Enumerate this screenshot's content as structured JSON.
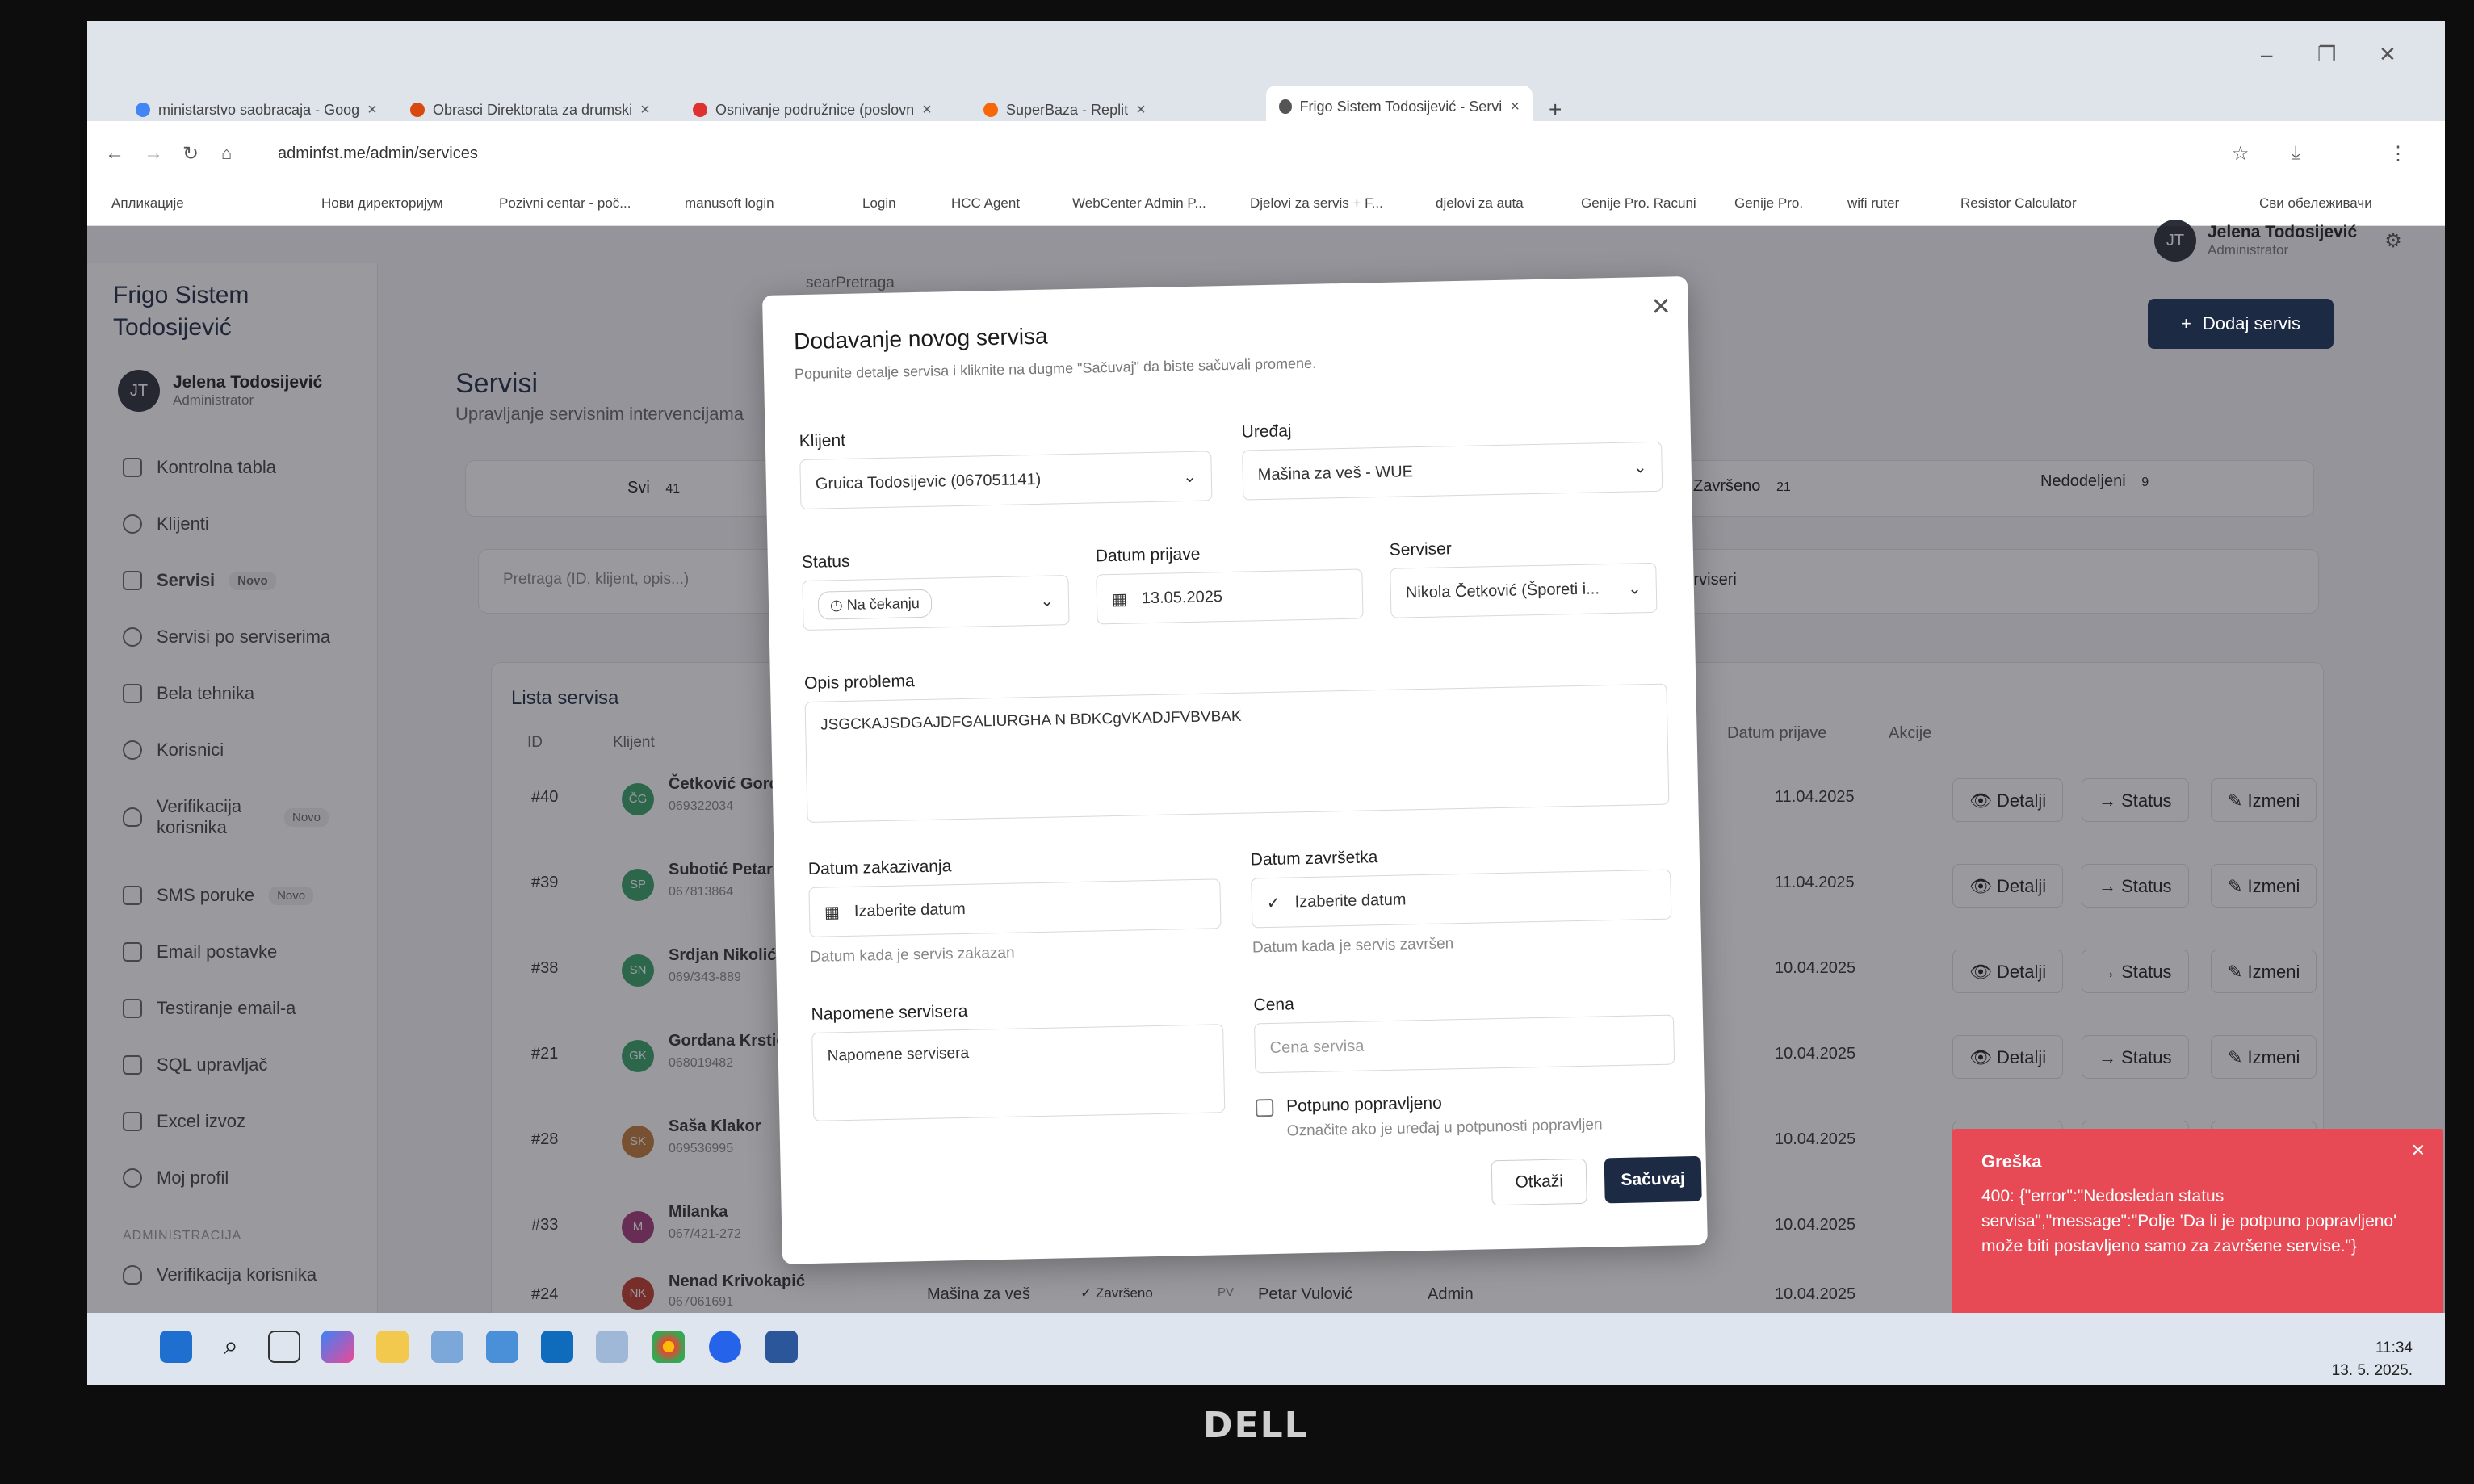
{
  "browser": {
    "tabs": [
      {
        "label": "ministarstvo saobracaja - Goog",
        "color": "#4285f4"
      },
      {
        "label": "Obrasci Direktorata za drumski",
        "color": "#d9480f"
      },
      {
        "label": "Osnivanje podružnice (poslovn",
        "color": "#e03131"
      },
      {
        "label": "SuperBaza - Replit",
        "color": "#f76707"
      },
      {
        "label": "Frigo Sistem Todosijević - Servi",
        "color": "#555555"
      }
    ],
    "url": "adminfst.me/admin/services",
    "bookmarks": [
      "Апликације",
      "Нови директоријум",
      "Pozivni centar - poč...",
      "manusoft login",
      "Login",
      "HCC Agent",
      "WebCenter Admin P...",
      "Djelovi za servis + F...",
      "djelovi za auta",
      "Genije Pro. Racuni",
      "Genije Pro.",
      "wifi ruter",
      "Resistor Calculator",
      "Сви обележивачи"
    ]
  },
  "sidebar": {
    "title": "Frigo Sistem Todosijević",
    "user_initials": "JT",
    "user_name": "Jelena Todosijević",
    "user_role": "Administrator",
    "items": [
      {
        "label": "Kontrolna tabla"
      },
      {
        "label": "Klijenti"
      },
      {
        "label": "Servisi",
        "badge": "Novo"
      },
      {
        "label": "Servisi po serviserima"
      },
      {
        "label": "Bela tehnika"
      },
      {
        "label": "Korisnici"
      },
      {
        "label": "Verifikacija korisnika",
        "badge": "Novo"
      },
      {
        "label": "SMS poruke",
        "badge": "Novo"
      },
      {
        "label": "Email postavke"
      },
      {
        "label": "Testiranje email-a"
      },
      {
        "label": "SQL upravljač"
      },
      {
        "label": "Excel izvoz"
      },
      {
        "label": "Moj profil"
      }
    ],
    "section": "ADMINISTRACIJA",
    "section_item": "Verifikacija korisnika"
  },
  "header": {
    "search_text": "searPretraga",
    "user_initials": "JT",
    "user_name": "Jelena Todosijević",
    "user_role": "Administrator"
  },
  "page": {
    "title": "Servisi",
    "subtitle": "Upravljanje servisnim intervencijama",
    "add_button": "Dodaj servis",
    "filter_all": "Svi",
    "filter_all_count": "41",
    "filter_done": "Završeno",
    "filter_done_count": "21",
    "filter_unassigned": "Nedodeljeni",
    "filter_unassigned_count": "9",
    "search_placeholder": "Pretraga (ID, klijent, opis...)",
    "servicer_filter": "Svi serviseri",
    "list_title": "Lista servisa",
    "col_id": "ID",
    "col_client": "Klijent",
    "col_date": "Datum prijave",
    "col_actions": "Akcije",
    "action_details": "Detalji",
    "action_status": "Status",
    "action_edit": "Izmeni"
  },
  "rows": [
    {
      "id": "#40",
      "initials": "ČG",
      "name": "Četković Gordana",
      "phone": "069322034",
      "date": "11.04.2025"
    },
    {
      "id": "#39",
      "initials": "SP",
      "name": "Subotić Petar",
      "phone": "067813864",
      "date": "11.04.2025"
    },
    {
      "id": "#38",
      "initials": "SN",
      "name": "Srdjan Nikolić",
      "phone": "069/343-889",
      "date": "10.04.2025"
    },
    {
      "id": "#21",
      "initials": "GK",
      "name": "Gordana Krstićević",
      "phone": "068019482",
      "date": "10.04.2025"
    },
    {
      "id": "#28",
      "initials": "SK",
      "name": "Saša Klakor",
      "phone": "069536995",
      "date": "10.04.2025"
    },
    {
      "id": "#33",
      "initials": "M",
      "name": "Milanka",
      "phone": "067/421-272",
      "date": "10.04.2025"
    },
    {
      "id": "#24",
      "initials": "NK",
      "name": "Nenad Krivokapić",
      "phone": "067061691",
      "date": "10.04.2025",
      "device": "Mašina za veš",
      "status": "Završeno",
      "tech_initials": "PV",
      "tech": "Petar Vulović",
      "role": "Admin"
    }
  ],
  "modal": {
    "title": "Dodavanje novog servisa",
    "subtitle": "Popunite detalje servisa i kliknite na dugme \"Sačuvaj\" da biste sačuvali promene.",
    "client_label": "Klijent",
    "client_value": "Gruica Todosijevic (067051141)",
    "device_label": "Uređaj",
    "device_value": "Mašina za veš - WUE",
    "status_label": "Status",
    "status_value": "Na čekanju",
    "date_label": "Datum prijave",
    "date_value": "13.05.2025",
    "servicer_label": "Serviser",
    "servicer_value": "Nikola Četković (Šporeti i...",
    "problem_label": "Opis problema",
    "problem_value": "JSGCKAJSDGAJDFGALIURGHA  N BDKCgVKADJFVBVBAK",
    "sched_label": "Datum zakazivanja",
    "sched_placeholder": "Izaberite datum",
    "sched_help": "Datum kada je servis zakazan",
    "done_label": "Datum završetka",
    "done_placeholder": "Izaberite datum",
    "done_help": "Datum kada je servis završen",
    "notes_label": "Napomene servisera",
    "notes_placeholder": "Napomene servisera",
    "price_label": "Cena",
    "price_placeholder": "Cena servisa",
    "repaired_label": "Potpuno popravljeno",
    "repaired_help": "Označite ako je uređaj u potpunosti popravljen",
    "cancel": "Otkaži",
    "save": "Sačuvaj"
  },
  "toast": {
    "title": "Greška",
    "message": "400: {\"error\":\"Nedosledan status servisa\",\"message\":\"Polje 'Da li je potpuno popravljeno' može biti postavljeno samo za završene servise.\"}",
    "color": "#e84a55"
  },
  "taskbar": {
    "time": "11:34",
    "date": "13. 5. 2025."
  },
  "monitor_brand": "DELL"
}
